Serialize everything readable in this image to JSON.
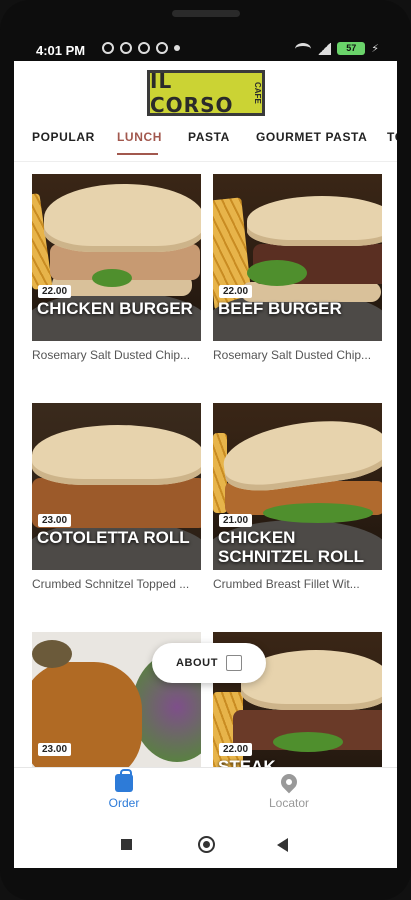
{
  "status": {
    "time": "4:01 PM",
    "battery": "57"
  },
  "app": {
    "logo_text": "IL CORSO",
    "logo_sub": "CAFE"
  },
  "tabs": [
    {
      "label": "POPULAR",
      "active": false
    },
    {
      "label": "LUNCH",
      "active": true
    },
    {
      "label": "PASTA",
      "active": false
    },
    {
      "label": "GOURMET PASTA",
      "active": false
    },
    {
      "label": "TO",
      "active": false
    }
  ],
  "menu_items": [
    {
      "price": "22.00",
      "title": "CHICKEN BURGER",
      "desc": "Rosemary Salt Dusted Chip..."
    },
    {
      "price": "22.00",
      "title": "BEEF BURGER",
      "desc": "Rosemary Salt Dusted Chip..."
    },
    {
      "price": "23.00",
      "title": "COTOLETTA ROLL",
      "desc": "Crumbed Schnitzel Topped ..."
    },
    {
      "price": "21.00",
      "title": "CHICKEN SCHNITZEL ROLL",
      "desc": "Crumbed Breast Fillet Wit..."
    },
    {
      "price": "23.00",
      "title": "",
      "desc": ""
    },
    {
      "price": "22.00",
      "title": "STEAK",
      "desc": ""
    }
  ],
  "about_button": {
    "label": "ABOUT"
  },
  "bottom_nav": [
    {
      "label": "Order",
      "icon": "shopping-bag-icon",
      "active": true
    },
    {
      "label": "Locator",
      "icon": "map-pin-icon",
      "active": false
    }
  ],
  "colors": {
    "accent": "#a2584e",
    "nav_active": "#2d7bd8",
    "logo_bg": "#cbd334"
  }
}
